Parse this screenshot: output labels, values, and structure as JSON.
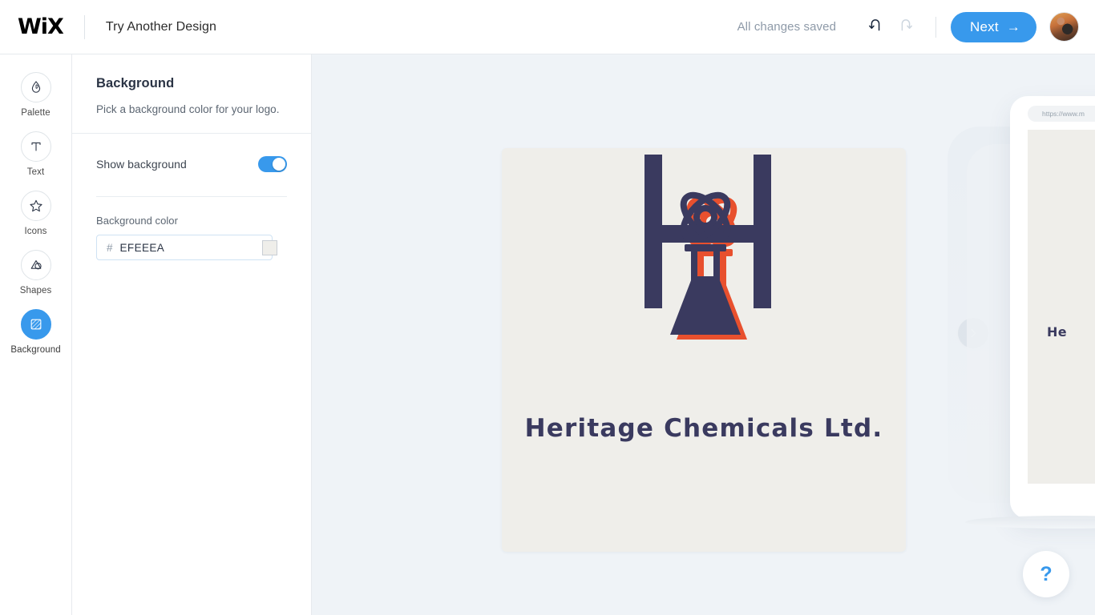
{
  "topbar": {
    "brand": "WiX",
    "page_label": "Try Another Design",
    "save_status": "All changes saved",
    "undo_icon": "undo-arrow-icon",
    "redo_icon": "redo-arrow-icon",
    "next_label": "Next",
    "next_arrow": "→",
    "avatar_name": "user-avatar"
  },
  "rail": {
    "items": [
      {
        "label": "Palette",
        "icon": "droplet-icon",
        "active": false
      },
      {
        "label": "Text",
        "icon": "text-t-icon",
        "active": false
      },
      {
        "label": "Icons",
        "icon": "star-icon",
        "active": false
      },
      {
        "label": "Shapes",
        "icon": "shapes-icon",
        "active": false
      },
      {
        "label": "Background",
        "icon": "hatch-square-icon",
        "active": true
      }
    ]
  },
  "panel": {
    "title": "Background",
    "subtitle": "Pick a background color for your logo.",
    "show_background_label": "Show background",
    "show_background_on": true,
    "background_color_label": "Background color",
    "hash": "#",
    "hex_value": "EFEEEA",
    "hex_placeholder": "EFEEEA",
    "swatch_color": "#EFEEEA"
  },
  "logo": {
    "company_name": "Heritage Chemicals Ltd.",
    "canvas_color": "#EFEEEA",
    "primary_color": "#3A3A5F",
    "accent_color": "#E8502E",
    "mark": "h-monogram-with-flask-and-atom"
  },
  "preview": {
    "url_text": "https://www.m",
    "device_logo_text": "He",
    "next_chevron": "chevron-right-icon"
  },
  "help": {
    "label": "?"
  },
  "colors": {
    "accent_blue": "#3899EC",
    "stage_bg": "#EFF3F7",
    "panel_bg": "#FFFFFF",
    "logo_navy": "#3A3A5F",
    "logo_orange": "#E8502E"
  }
}
